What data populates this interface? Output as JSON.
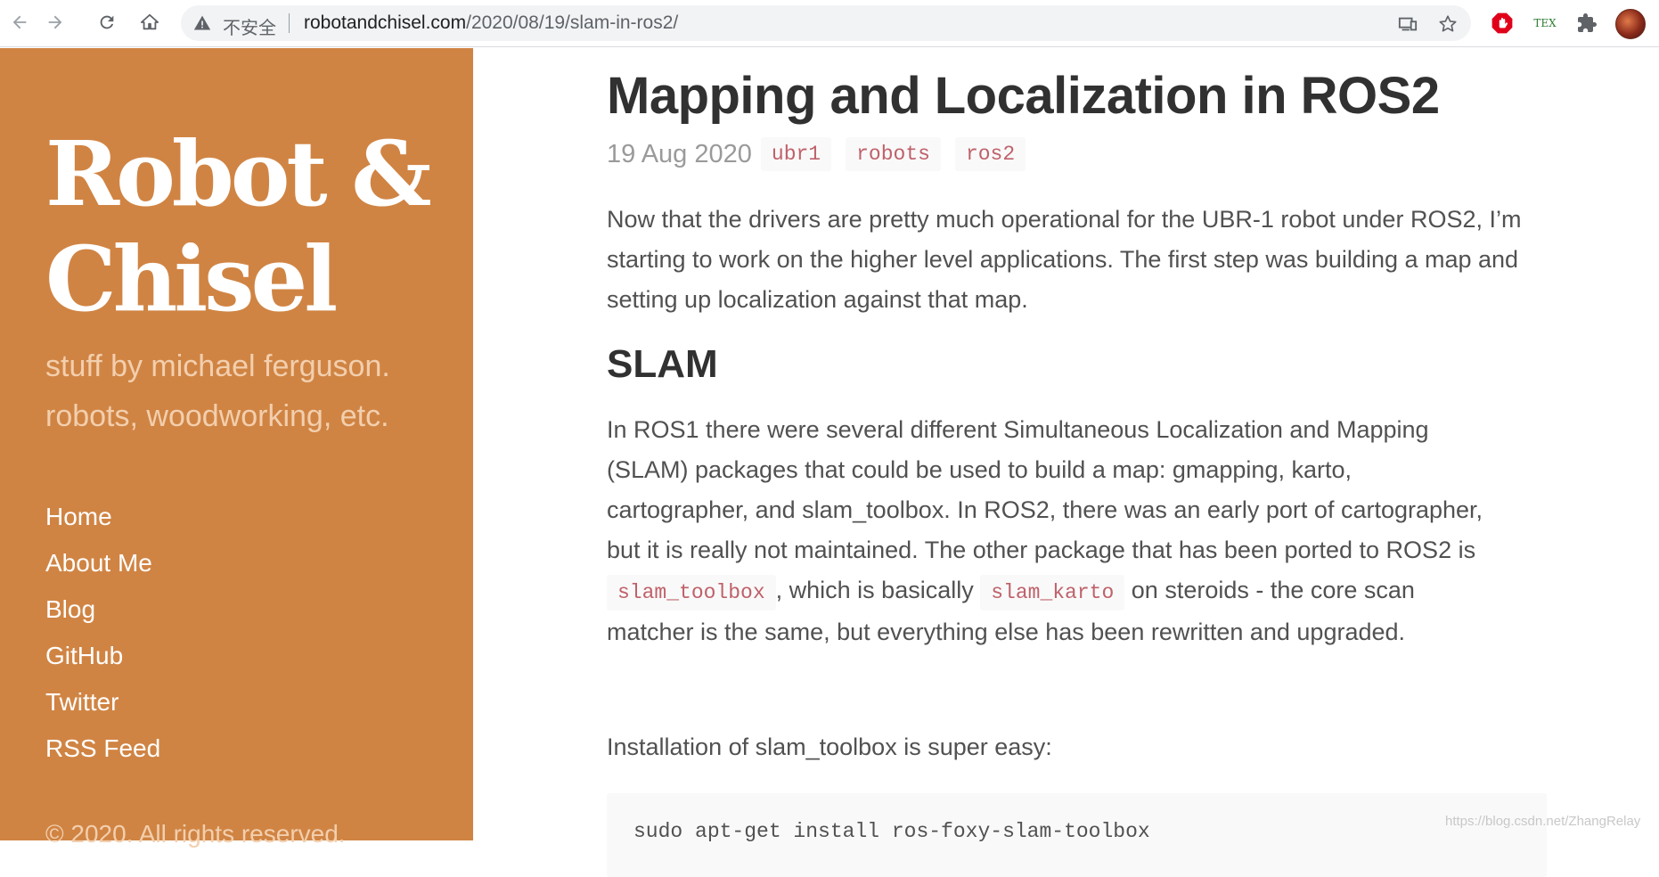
{
  "browser": {
    "security_text": "不安全",
    "url_host": "robotandchisel.com",
    "url_path": "/2020/08/19/slam-in-ros2/",
    "icons": [
      "back-arrow-icon",
      "forward-arrow-icon",
      "reload-icon",
      "home-icon",
      "warning-icon",
      "cast-icon",
      "star-icon",
      "stop-sign-icon",
      "tex-icon",
      "puzzle-icon",
      "avatar"
    ],
    "tex_label": "TEX"
  },
  "sidebar": {
    "title": "Robot & Chisel",
    "lead": "stuff by michael ferguson. robots, woodworking, etc.",
    "nav": [
      "Home",
      "About Me",
      "Blog",
      "GitHub",
      "Twitter",
      "RSS Feed"
    ],
    "copyright": "© 2020. All rights reserved.",
    "bg_color": "#d08443"
  },
  "post": {
    "title": "Mapping and Localization in ROS2",
    "date": "19 Aug 2020",
    "tags": [
      "ubr1",
      "robots",
      "ros2"
    ],
    "intro": "Now that the drivers are pretty much operational for the UBR-1 robot under ROS2, I’m starting to work on the higher level applications. The first step was building a map and setting up localization against that map.",
    "slam_heading": "SLAM",
    "slam_line1": "In ROS1 there were several different Simultaneous Localization and Mapping",
    "slam_line2": "(SLAM) packages that could be used to build a map: gmapping, karto,",
    "slam_line3": "cartographer, and slam_toolbox. In ROS2, there was an early port of cartographer,",
    "slam_line4": "but it is really not maintained. The other package that has been ported to ROS2 is",
    "slam_code1": "slam_toolbox",
    "slam_text5a": ", which is basically",
    "slam_code2": "slam_karto",
    "slam_text5b": "on steroids - the core scan",
    "slam_line6": "matcher is the same, but everything else has been rewritten and upgraded.",
    "install_text": "Installation of slam_toolbox is super easy:",
    "install_cmd": "sudo apt-get install ros-foxy-slam-toolbox"
  },
  "watermark": "https://blog.csdn.net/ZhangRelay"
}
